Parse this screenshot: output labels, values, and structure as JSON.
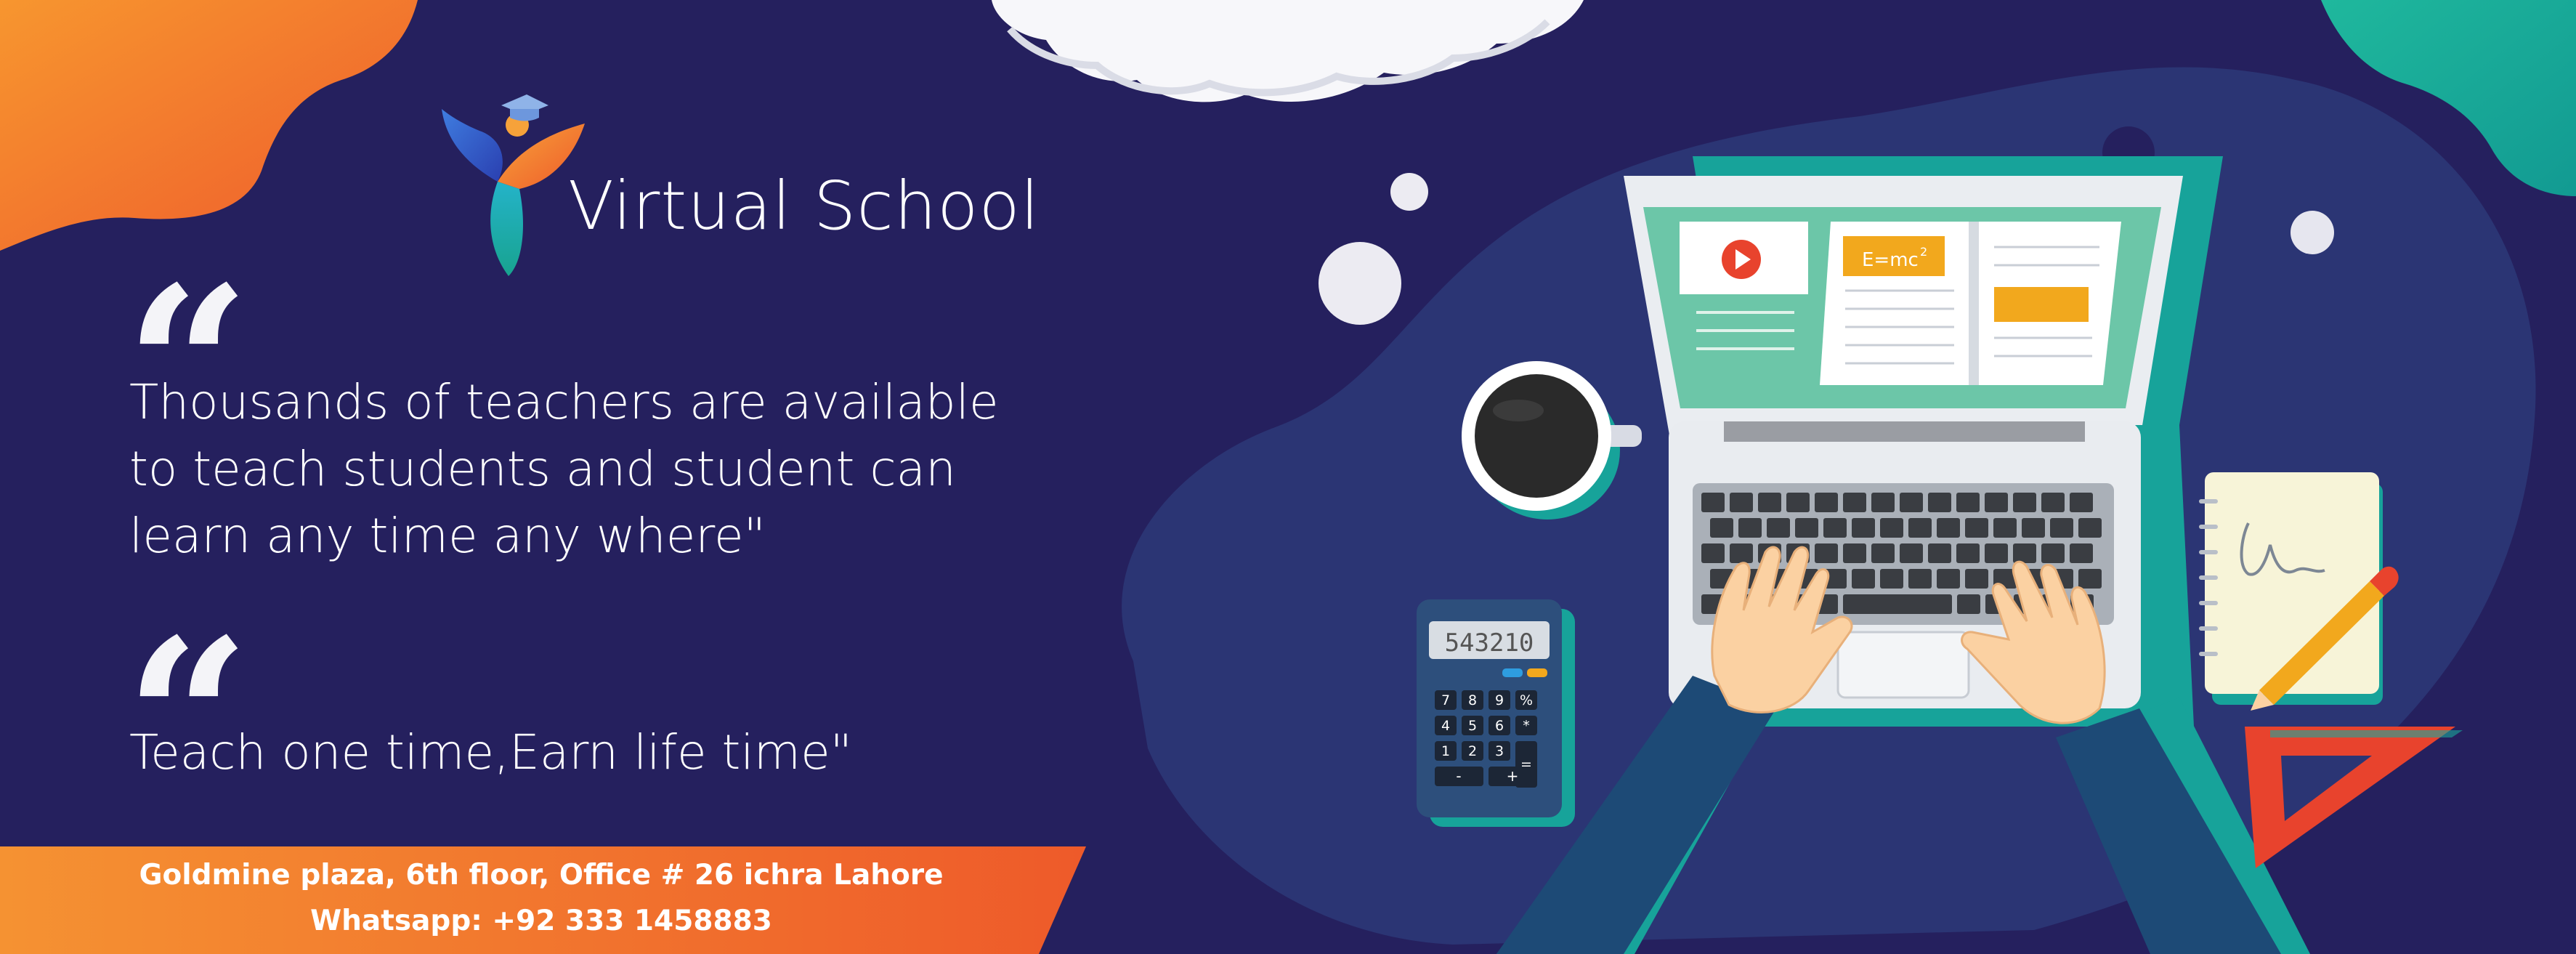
{
  "brand": {
    "name": "Virtual School",
    "logo_icon": "graduate-figure-logo"
  },
  "quotes": [
    {
      "mark": "“",
      "text": "Thousands of teachers are available to teach students and student can learn any time any where\""
    },
    {
      "mark": "“",
      "text": "Teach one time,Earn life time\""
    }
  ],
  "footer": {
    "address": "Goldmine plaza, 6th floor, Office # 26 ichra Lahore",
    "whatsapp": "Whatsapp: +92 333 1458883"
  },
  "illustration": {
    "screen_formula": "E=mc",
    "screen_formula_exp": "2",
    "calculator_display": "543210",
    "calculator_keys": [
      "7",
      "8",
      "9",
      "%",
      "4",
      "5",
      "6",
      "*",
      "1",
      "2",
      "3",
      "=",
      "-",
      "+"
    ]
  },
  "colors": {
    "background": "#25205e",
    "blob": "#2b3574",
    "orange": "#f26a2e",
    "teal": "#1ba89b",
    "screen_green": "#6cc6a8",
    "yellow": "#f2a81d",
    "red": "#e8432d"
  }
}
